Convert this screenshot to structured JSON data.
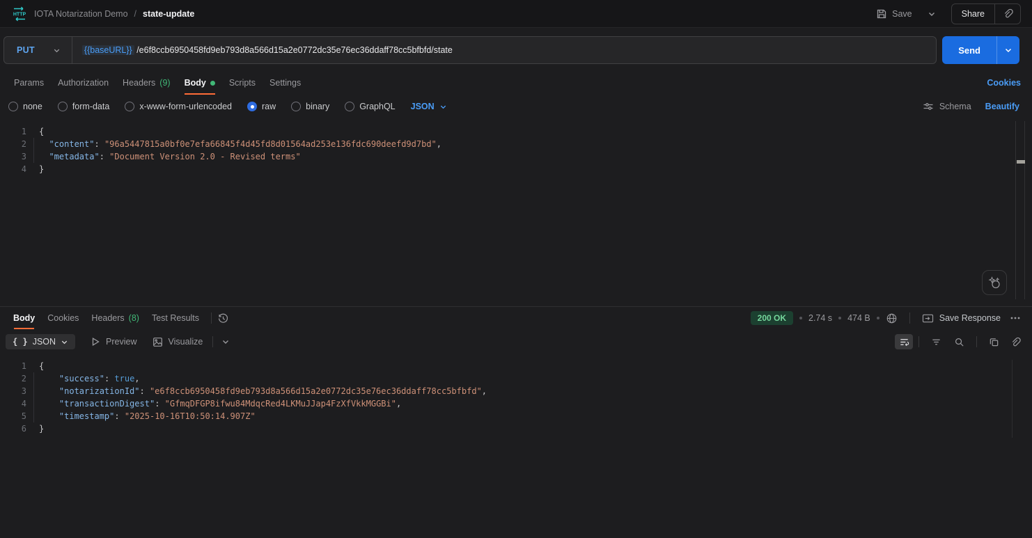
{
  "header": {
    "collection_name": "IOTA Notarization Demo",
    "breadcrumb_separator": "/",
    "request_name": "state-update",
    "save_label": "Save",
    "share_label": "Share"
  },
  "request": {
    "method": "PUT",
    "url_variable": "{{baseURL}}",
    "url_path": "/e6f8ccb6950458fd9eb793d8a566d15a2e0772dc35e76ec36ddaff78cc5bfbfd/state",
    "send_label": "Send",
    "tabs": [
      {
        "label": "Params"
      },
      {
        "label": "Authorization"
      },
      {
        "label": "Headers",
        "count": "(9)"
      },
      {
        "label": "Body",
        "active": true
      },
      {
        "label": "Scripts"
      },
      {
        "label": "Settings"
      }
    ],
    "cookies_link": "Cookies",
    "body_modes": [
      "none",
      "form-data",
      "x-www-form-urlencoded",
      "raw",
      "binary",
      "GraphQL"
    ],
    "selected_mode": "raw",
    "language_selector": "JSON",
    "schema_label": "Schema",
    "beautify_label": "Beautify",
    "code": [
      [
        [
          "p",
          "{"
        ]
      ],
      [
        [
          "w",
          "  "
        ],
        [
          "k",
          "\"content\""
        ],
        [
          "p",
          ": "
        ],
        [
          "s",
          "\"96a5447815a0bf0e7efa66845f4d45fd8d01564ad253e136fdc690deefd9d7bd\""
        ],
        [
          "p",
          ","
        ]
      ],
      [
        [
          "w",
          "  "
        ],
        [
          "k",
          "\"metadata\""
        ],
        [
          "p",
          ": "
        ],
        [
          "s",
          "\"Document Version 2.0 - Revised terms\""
        ]
      ],
      [
        [
          "p",
          "}"
        ]
      ]
    ]
  },
  "response": {
    "tabs": [
      {
        "label": "Body",
        "active": true
      },
      {
        "label": "Cookies"
      },
      {
        "label": "Headers",
        "count": "(8)"
      },
      {
        "label": "Test Results"
      }
    ],
    "status": {
      "code_text": "200 OK",
      "time": "2.74 s",
      "size": "474 B"
    },
    "save_response_label": "Save Response",
    "format_selector": "JSON",
    "preview_label": "Preview",
    "visualize_label": "Visualize",
    "code": [
      [
        [
          "p",
          "{"
        ]
      ],
      [
        [
          "w",
          "    "
        ],
        [
          "k",
          "\"success\""
        ],
        [
          "p",
          ": "
        ],
        [
          "b",
          "true"
        ],
        [
          "p",
          ","
        ]
      ],
      [
        [
          "w",
          "    "
        ],
        [
          "k",
          "\"notarizationId\""
        ],
        [
          "p",
          ": "
        ],
        [
          "s",
          "\"e6f8ccb6950458fd9eb793d8a566d15a2e0772dc35e76ec36ddaff78cc5bfbfd\""
        ],
        [
          "p",
          ","
        ]
      ],
      [
        [
          "w",
          "    "
        ],
        [
          "k",
          "\"transactionDigest\""
        ],
        [
          "p",
          ": "
        ],
        [
          "s",
          "\"GfmqDFGP8ifwu84MdqcRed4LKMuJJap4FzXfVkkMGGBi\""
        ],
        [
          "p",
          ","
        ]
      ],
      [
        [
          "w",
          "    "
        ],
        [
          "k",
          "\"timestamp\""
        ],
        [
          "p",
          ": "
        ],
        [
          "s",
          "\"2025-10-16T10:50:14.907Z\""
        ]
      ],
      [
        [
          "p",
          "}"
        ]
      ]
    ]
  },
  "colors": {
    "accent_blue": "#4a9cf6",
    "method_put_blue": "#5ea5f0",
    "send_button_blue": "#1a6ce0",
    "active_tab_orange": "#ff6c37",
    "success_green": "#41b877",
    "status_badge_bg": "#1c4030",
    "status_badge_text": "#75d69c",
    "code_key": "#85b6e6",
    "code_string": "#ce9178",
    "code_boolean": "#569cd6",
    "http_icon_teal": "#2fc9c9"
  }
}
